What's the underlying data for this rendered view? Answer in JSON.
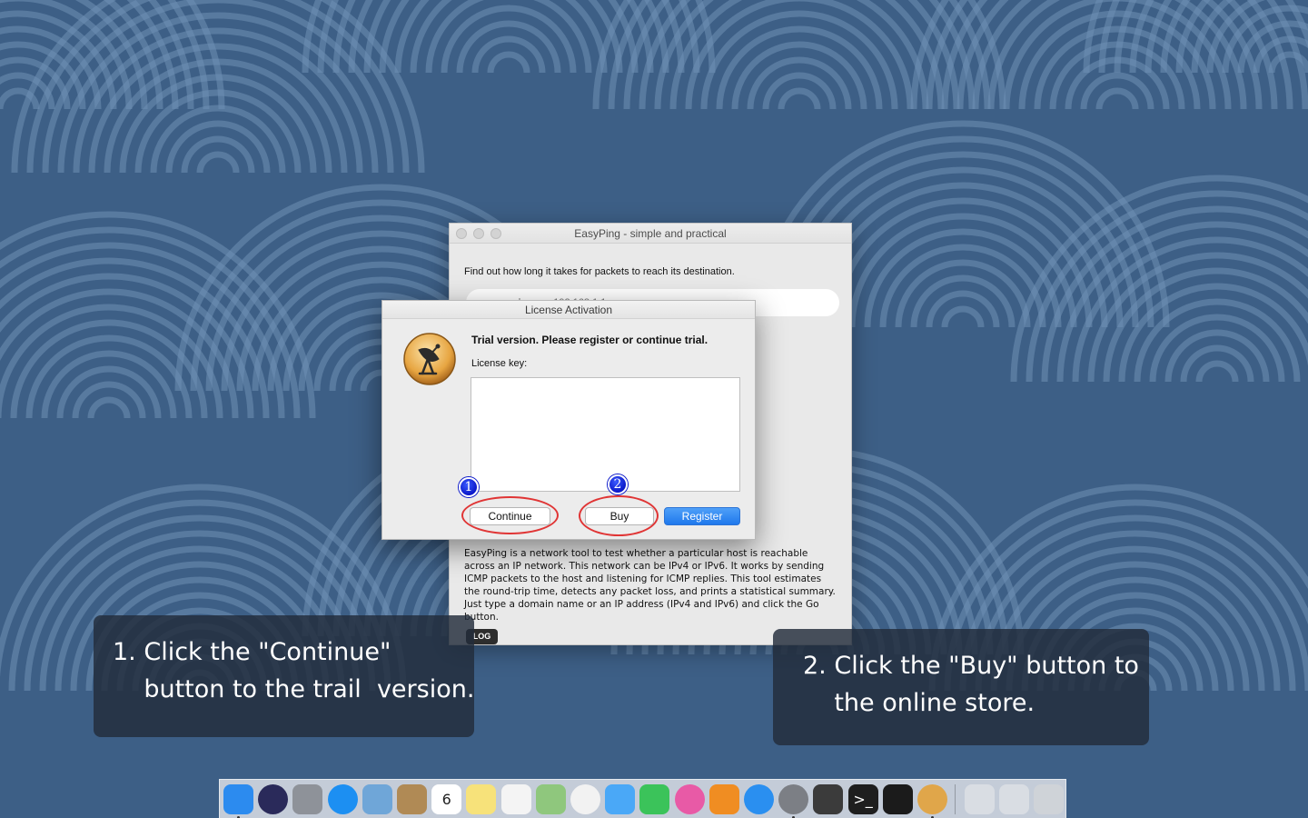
{
  "desktop": {
    "wallpaper": "concentric-arcs-pattern",
    "colors": {
      "base": "#3d5f86",
      "arc": "#6f8fb4"
    }
  },
  "main_window": {
    "title": "EasyPing - simple and practical",
    "intro": "Find out how long it takes for packets to reach its destination.",
    "host_placeholder": "e.g. apple.com, 192.168.1.1",
    "host_visible_suffix": "com",
    "description": "EasyPing is a network tool to test whether a particular host is reachable across an IP network. This network can be IPv4 or IPv6. It works by sending ICMP packets to the host and listening for ICMP replies. This tool estimates the round-trip time, detects any packet loss, and prints a statistical summary. Just type a domain name or an IP address (IPv4 and IPv6) and click the Go button.",
    "log_button": "LOG"
  },
  "license_dialog": {
    "title": "License Activation",
    "message": "Trial version. Please register or continue trial.",
    "license_label": "License key:",
    "license_value": "",
    "buttons": {
      "continue": "Continue",
      "buy": "Buy",
      "register": "Register"
    },
    "badges": {
      "continue": "1",
      "buy": "2"
    },
    "colors": {
      "primary": "#1f78ec",
      "highlight_ring": "#e03535",
      "badge": "#0a17c9"
    }
  },
  "callouts": {
    "left": {
      "line1": "1. Click the \"Continue\"",
      "line2": "    button to the trail  version."
    },
    "right": {
      "line1": "2. Click the \"Buy\" button to",
      "line2": "    the online store."
    }
  },
  "dock": {
    "items": [
      {
        "name": "finder-icon",
        "color": "#2c8bef"
      },
      {
        "name": "siri-icon",
        "color": "#2a2a5a"
      },
      {
        "name": "launchpad-icon",
        "color": "#8e9299"
      },
      {
        "name": "safari-icon",
        "color": "#1c8ff2"
      },
      {
        "name": "preview-icon",
        "color": "#6fa6d8"
      },
      {
        "name": "contacts-icon",
        "color": "#b08a55"
      },
      {
        "name": "calendar-icon",
        "color": "#ffffff",
        "text": "6"
      },
      {
        "name": "notes-icon",
        "color": "#f7e27a"
      },
      {
        "name": "reminders-icon",
        "color": "#f4f4f4"
      },
      {
        "name": "maps-icon",
        "color": "#8fc77d"
      },
      {
        "name": "photos-icon",
        "color": "#f2f2f2"
      },
      {
        "name": "messages-icon",
        "color": "#4aa8f7"
      },
      {
        "name": "facetime-icon",
        "color": "#3bc35a"
      },
      {
        "name": "itunes-icon",
        "color": "#e85aa6"
      },
      {
        "name": "ibooks-icon",
        "color": "#f08d22"
      },
      {
        "name": "app-store-icon",
        "color": "#2a8ff0"
      },
      {
        "name": "system-preferences-icon",
        "color": "#7c7f85"
      },
      {
        "name": "sublime-text-icon",
        "color": "#3b3b3b"
      },
      {
        "name": "terminal-icon",
        "color": "#1e1e1e",
        "text": ">_"
      },
      {
        "name": "activity-monitor-icon",
        "color": "#1b1b1b"
      },
      {
        "name": "easyping-icon",
        "color": "#e0a64a"
      },
      {
        "name": "downloads-stack-icon",
        "color": "#d9dde3"
      },
      {
        "name": "documents-stack-icon",
        "color": "#d9dde3"
      },
      {
        "name": "trash-icon",
        "color": "#cfd3d8"
      }
    ]
  }
}
